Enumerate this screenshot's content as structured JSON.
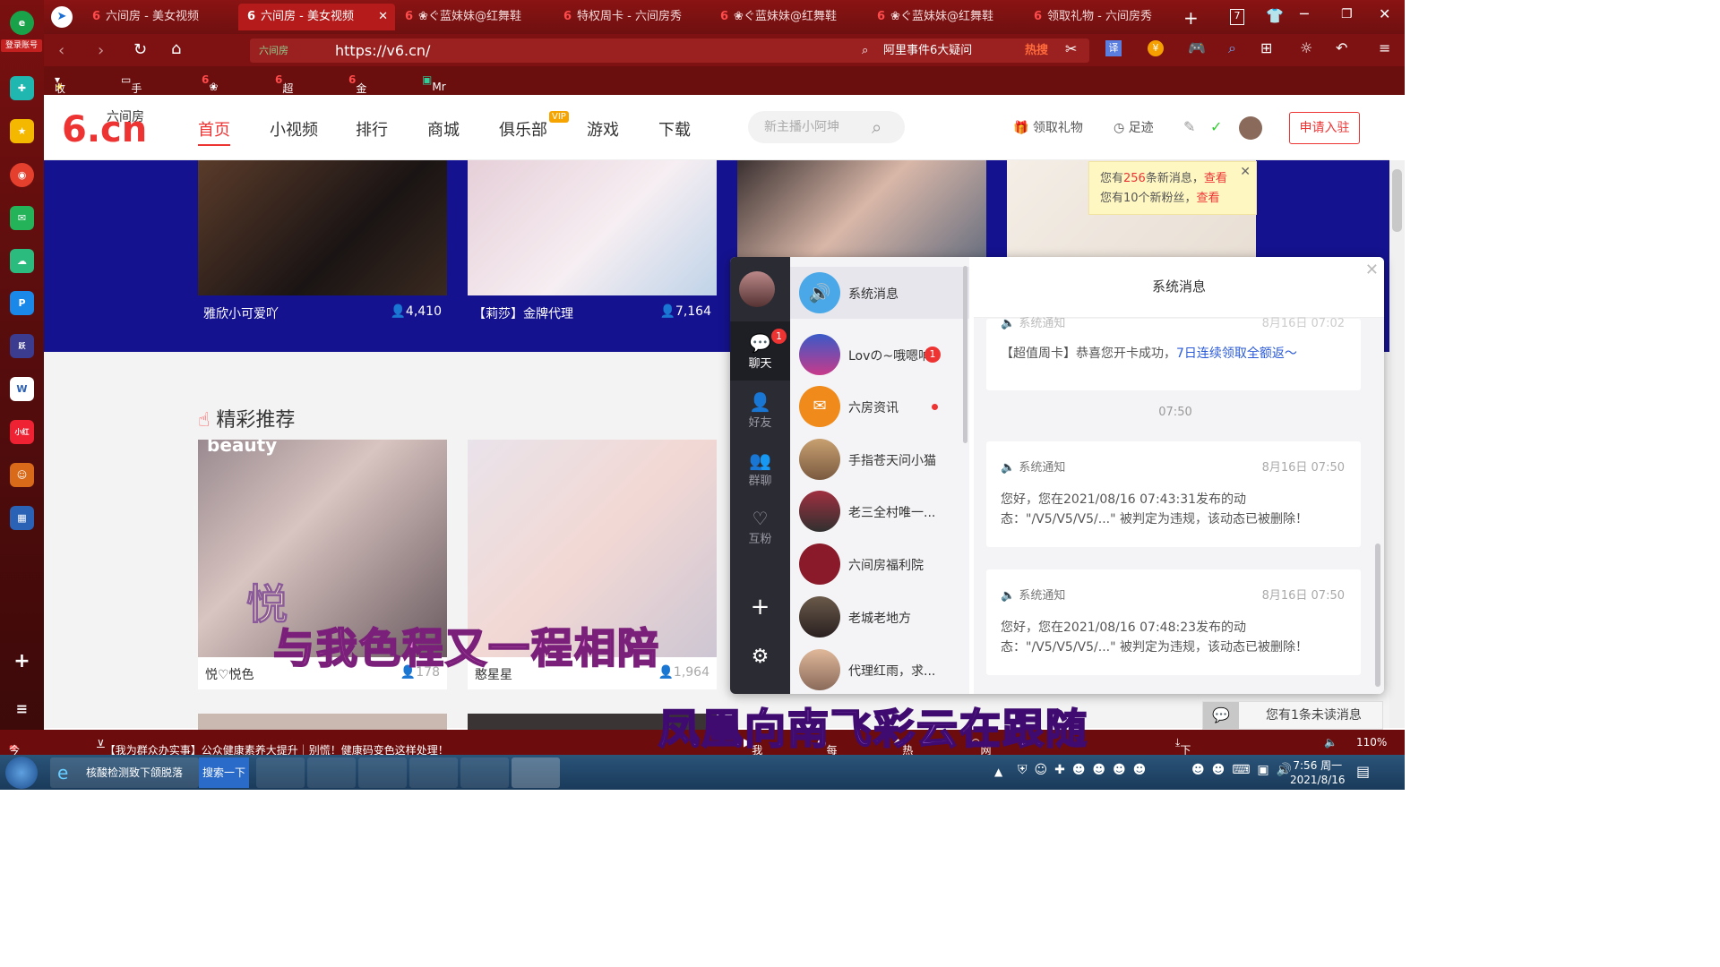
{
  "sidebar": {
    "account_label": "登录账号"
  },
  "tabs": [
    {
      "label": "六间房 - 美女视频"
    },
    {
      "label": "六间房 - 美女视频"
    },
    {
      "label": "❀ぐ蓝妹妹@红舞鞋"
    },
    {
      "label": "特权周卡 - 六间房秀"
    },
    {
      "label": "❀ぐ蓝妹妹@红舞鞋"
    },
    {
      "label": "❀ぐ蓝妹妹@红舞鞋"
    },
    {
      "label": "领取礼物 - 六间房秀"
    }
  ],
  "tab_count": "7",
  "address": {
    "url": "https://v6.cn/",
    "site_tag": "六间房"
  },
  "search_bar": {
    "text": "阿里事件6大疑问",
    "hot": "热搜"
  },
  "bookmarks": [
    "收藏",
    "手机收藏夹",
    "❀ぐ蓝妹",
    "超级周卡",
    "金蟾捕鱼",
    "Mr小多"
  ],
  "header": {
    "logo_small": "六间房",
    "logo_big": "6.cn",
    "nav": [
      "首页",
      "小视频",
      "排行",
      "商城",
      "俱乐部",
      "游戏",
      "下载"
    ],
    "vip_badge": "VIP",
    "search_placeholder": "新主播小阿坤",
    "gift": "领取礼物",
    "footprint": "足迹",
    "apply": "申请入驻"
  },
  "top_cards": [
    {
      "name": "雅欣小可爱吖",
      "viewers": "4,410"
    },
    {
      "name": "【莉莎】金牌代理",
      "viewers": "7,164"
    }
  ],
  "notice": {
    "line1_pre": "您有",
    "line1_num": "256",
    "line1_mid": "条新消息，",
    "line1_link": "查看",
    "line2_pre": "您有10个新粉丝，",
    "line2_link": "查看"
  },
  "section_title": "精彩推荐",
  "rec_cards": [
    {
      "name": "悦♡悦色",
      "viewers": "178",
      "overlay": "beauty"
    },
    {
      "name": "憨星星",
      "viewers": "1,964"
    }
  ],
  "chat": {
    "nav": [
      {
        "label": "聊天",
        "badge": "1"
      },
      {
        "label": "好友"
      },
      {
        "label": "群聊"
      },
      {
        "label": "互粉"
      }
    ],
    "list": [
      {
        "name": "系统消息"
      },
      {
        "name": "Lovの~哦嗯呐",
        "badge": "1"
      },
      {
        "name": "六房资讯"
      },
      {
        "name": "手指苍天问小猫"
      },
      {
        "name": "老三全村唯一..."
      },
      {
        "name": "六间房福利院"
      },
      {
        "name": "老城老地方"
      },
      {
        "name": "代理红雨，求..."
      }
    ],
    "title": "系统消息",
    "messages": [
      {
        "head": "系统通知",
        "time": "8月16日 07:02",
        "body_pre": "【超值周卡】恭喜您开卡成功，",
        "body_link": "7日连续领取全额返～"
      },
      {
        "head": "系统通知",
        "time": "8月16日 07:50",
        "body": "您好，您在2021/08/16 07:43:31发布的动态：\"/V5/V5/V5/...\" 被判定为违规，该动态已被删除！"
      },
      {
        "head": "系统通知",
        "time": "8月16日 07:50",
        "body": "您好，您在2021/08/16 07:48:23发布的动态：\"/V5/V5/V5/...\" 被判定为违规，该动态已被删除！"
      }
    ],
    "divider_time": "07:50",
    "unread": "您有1条未读消息"
  },
  "overlays": [
    "与我色程又一程相陪",
    "凤凰向南飞彩云在跟随"
  ],
  "overlay_small": "悦",
  "statusbar": {
    "left": "今日优选",
    "news": "【我为群众办实事】公众健康素养大提升｜别慌！健康码变色这样处理！",
    "items": [
      "我的视频",
      "每日关注",
      "热点资讯",
      "网站信用",
      "下载"
    ],
    "zoom": "110%"
  },
  "taskbar": {
    "ie_title": "核酸检测致下颌脱落",
    "search": "搜索一下",
    "time": "7:56 周一",
    "date": "2021/8/16"
  },
  "colors": {
    "browser_red": "#8a1313",
    "band_blue": "#15128f",
    "accent_red": "#e33333"
  }
}
